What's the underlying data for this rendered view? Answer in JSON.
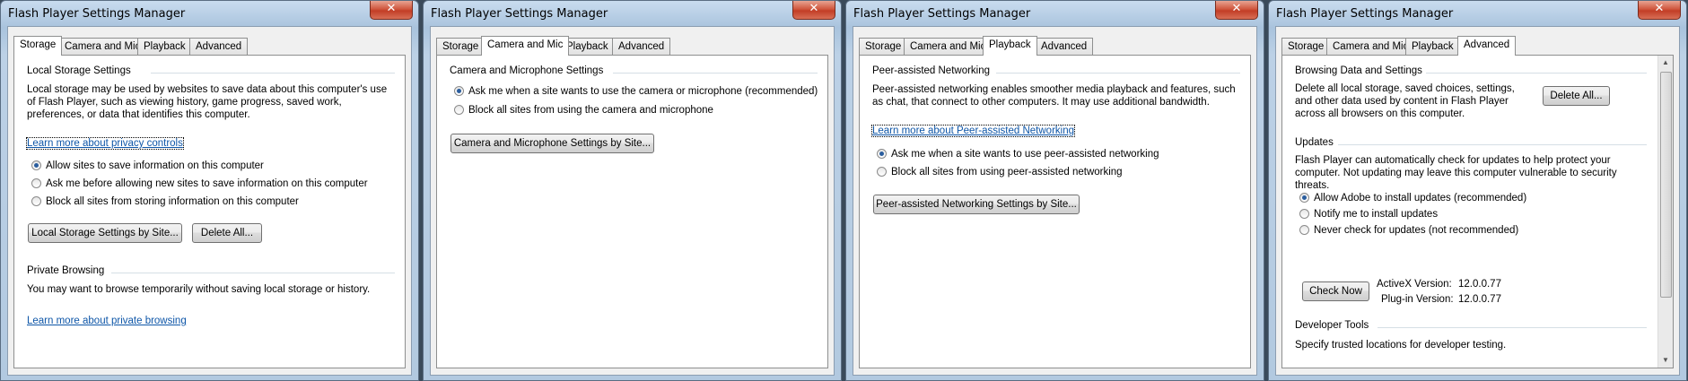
{
  "app": {
    "title": "Flash Player Settings Manager",
    "close_glyph": "✕"
  },
  "tabs": [
    "Storage",
    "Camera and Mic",
    "Playback",
    "Advanced"
  ],
  "storage": {
    "section1": "Local Storage Settings",
    "desc": "Local storage may be used by websites to save data about this computer's use of Flash Player, such as viewing history, game progress, saved work, preferences, or data that identifies this computer.",
    "privacy_link": "Learn more about privacy controls",
    "options": [
      "Allow sites to save information on this computer",
      "Ask me before allowing new sites to save information on this computer",
      "Block all sites from storing information on this computer"
    ],
    "selected": 0,
    "btn_site": "Local Storage Settings by Site...",
    "btn_delete": "Delete All...",
    "section2": "Private Browsing",
    "private_desc": "You may want to browse temporarily without saving local storage or history.",
    "private_link": "Learn more about private browsing"
  },
  "camera": {
    "section": "Camera and Microphone Settings",
    "options": [
      "Ask me when a site wants to use the camera or microphone (recommended)",
      "Block all sites from using the camera and microphone"
    ],
    "selected": 0,
    "btn_site": "Camera and Microphone Settings by Site..."
  },
  "playback": {
    "section": "Peer-assisted Networking",
    "desc": "Peer-assisted networking enables smoother media playback and features, such as chat, that connect to other computers. It may use additional bandwidth.",
    "link": "Learn more about Peer-assisted Networking",
    "options": [
      "Ask me when a site wants to use peer-assisted networking",
      "Block all sites from using peer-assisted networking"
    ],
    "selected": 0,
    "btn_site": "Peer-assisted Networking Settings by Site..."
  },
  "advanced": {
    "section1": "Browsing Data and Settings",
    "browse_desc": "Delete all local storage, saved choices, settings, and other data used by content in Flash Player across all browsers on this computer.",
    "btn_delete": "Delete All...",
    "section2": "Updates",
    "updates_desc": "Flash Player can automatically check for updates to help protect your computer. Not updating may leave this computer vulnerable to security threats.",
    "options": [
      "Allow Adobe to install updates (recommended)",
      "Notify me to install updates",
      "Never check for updates (not recommended)"
    ],
    "selected": 0,
    "btn_check": "Check Now",
    "activex_label": "ActiveX Version:",
    "activex_value": "12.0.0.77",
    "plugin_label": "Plug-in Version:",
    "plugin_value": "12.0.0.77",
    "section3": "Developer Tools",
    "dev_desc": "Specify trusted locations for developer testing."
  }
}
